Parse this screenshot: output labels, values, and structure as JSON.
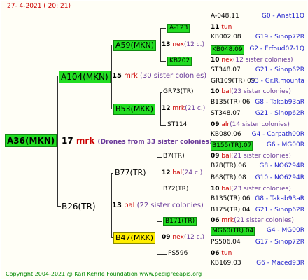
{
  "header": {
    "date": "27-   4-2021  ( 20: 21)"
  },
  "footer": {
    "copyright": "Copyright 2004-2021 @ Karl Kehrle Foundation    www.pedigreeapis.org"
  },
  "root": {
    "label": "A36(MKN)",
    "gen_num": "17",
    "gen_code": "mrk",
    "note": "(Drones from 33 sister colonies)"
  },
  "l1": {
    "top": {
      "label": "A104(MKN)",
      "num": "15",
      "code": "mrk",
      "note": "(30 sister colonies)"
    },
    "bottom": {
      "label": "B26(TR)",
      "num": "13",
      "code": "bal",
      "note": "(22 sister colonies)"
    }
  },
  "l2": {
    "a59": {
      "label": "A59(MKN)",
      "num": "13",
      "code": "nex",
      "note": "(12 c.)"
    },
    "b53": {
      "label": "B53(MKK)",
      "num": "12",
      "code": "mrk",
      "note": "(21 c.)"
    },
    "b77": {
      "label": "B77(TR)",
      "num": "12",
      "code": "bal",
      "note": "(24 c.)"
    },
    "b47": {
      "label": "B47(MKK)",
      "num": "09",
      "code": "nex",
      "note": "(12 c.)"
    }
  },
  "l3": {
    "a123": {
      "label": "A-123",
      "num": "11",
      "code": "tun",
      "note": ""
    },
    "kb202": {
      "label": "KB202",
      "num": "10",
      "code": "nex",
      "note": "(12 sister colonies)"
    },
    "gr73": {
      "label": "GR73(TR)",
      "num": "10",
      "code": "bal",
      "note": "(23 sister colonies)"
    },
    "st114": {
      "label": "ST114",
      "num": "09",
      "code": "alr",
      "note": "(14 sister colonies)"
    },
    "b7": {
      "label": "B7(TR)",
      "num": "09",
      "code": "bal",
      "note": "(21 sister colonies)"
    },
    "b72": {
      "label": "B72(TR)",
      "num": "10",
      "code": "bal",
      "note": "(23 sister colonies)"
    },
    "b171": {
      "label": "B171(TR)",
      "num": "06",
      "code": "mrk",
      "note": "(21 sister colonies)"
    },
    "ps596": {
      "label": "PS596",
      "num": "06",
      "code": "tun",
      "note": ""
    }
  },
  "l4": [
    {
      "name": "A-048.11",
      "ref": "G0 - Anat11Q"
    },
    {
      "name": "KB002.08",
      "ref": "G19 - Sinop72R"
    },
    {
      "name": "KB048.09",
      "ref": "G2 - Erfoud07-1Q"
    },
    {
      "name": "ST348.07",
      "ref": "G21 - Sinop62R"
    },
    {
      "name": "GR109(TR).09",
      "ref": "G3 - Gr.R.mounta"
    },
    {
      "name": "B135(TR).06",
      "ref": "G8 - Takab93aR"
    },
    {
      "name": "ST348.07",
      "ref": "G21 - Sinop62R"
    },
    {
      "name": "KB080.06",
      "ref": "G4 - Carpath00R"
    },
    {
      "name": "B155(TR).07",
      "ref": "G6 - MG00R"
    },
    {
      "name": "B78(TR).06",
      "ref": "G8 - NO6294R"
    },
    {
      "name": "B68(TR).08",
      "ref": "G10 - NO6294R"
    },
    {
      "name": "B135(TR).06",
      "ref": "G8 - Takab93aR"
    },
    {
      "name": "B175(TR).04",
      "ref": "G21 - Sinop62R"
    },
    {
      "name": "MG60(TR).04",
      "ref": "G4 - MG00R"
    },
    {
      "name": "PS506.04",
      "ref": "G17 - Sinop72R"
    },
    {
      "name": "KB169.03",
      "ref": "G6 - Maced93R"
    }
  ]
}
